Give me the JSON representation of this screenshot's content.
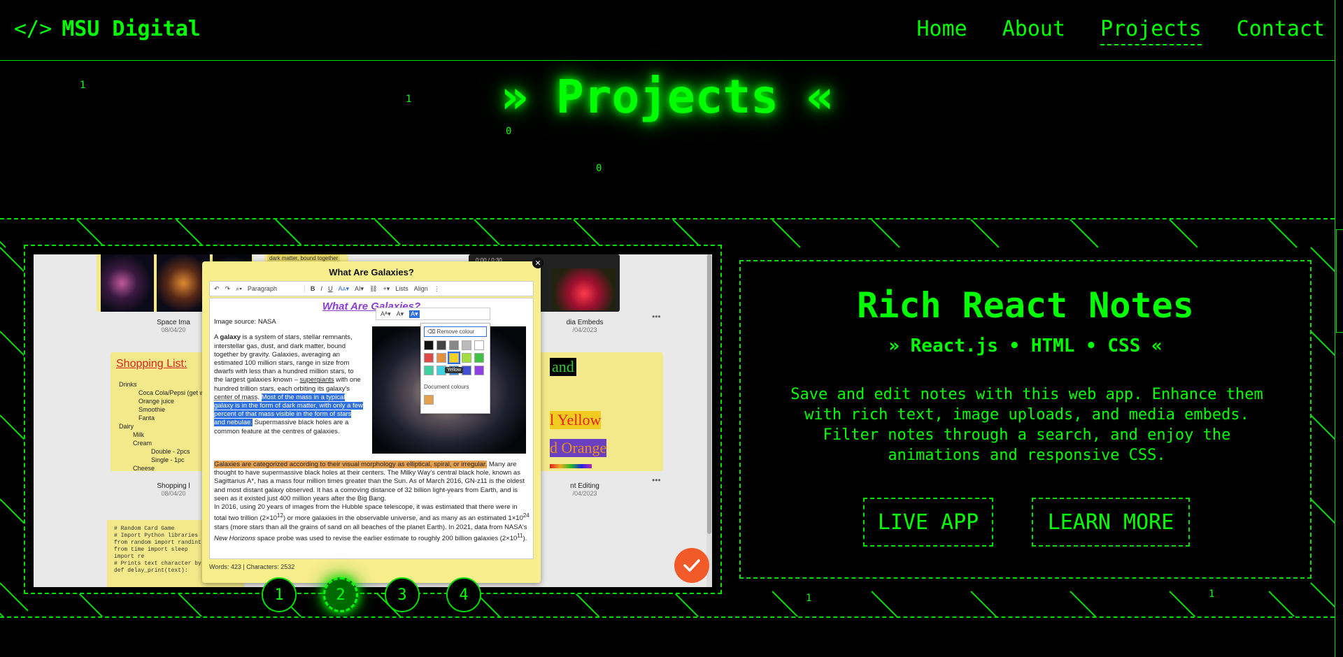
{
  "header": {
    "logo_code": "</>",
    "logo_text": "MSU Digital",
    "nav": [
      {
        "label": "Home",
        "active": false
      },
      {
        "label": "About",
        "active": false
      },
      {
        "label": "Projects",
        "active": true
      },
      {
        "label": "Contact",
        "active": false
      }
    ]
  },
  "matrix_digits": [
    "1",
    "1",
    "0",
    "0",
    "1",
    "1"
  ],
  "page_title": "» Projects «",
  "project": {
    "title": "Rich React Notes",
    "tech": "» React.js • HTML • CSS «",
    "description": "Save and edit notes with this web app. Enhance them with rich text, image uploads, and media embeds. Filter notes through a search, and enjoy the animations and responsive CSS.",
    "live_label": "LIVE APP",
    "learn_label": "LEARN MORE"
  },
  "pager": {
    "pages": [
      "1",
      "2",
      "3",
      "4"
    ],
    "active_index": 1
  },
  "screenshot": {
    "modal_title": "What Are Galaxies?",
    "toolbar_paragraph": "Paragraph",
    "toolbar_lists": "Lists",
    "toolbar_align": "Align",
    "note_heading": "What Are Galaxies?",
    "image_source": "Image source: NASA",
    "para1_a": "A ",
    "para1_bold": "galaxy",
    "para1_b": " is a system of stars, stellar remnants, interstellar gas, dust, and dark matter, bound together by gravity. Galaxies, averaging an estimated 100 million stars, range in size from dwarfs with less than a hundred million stars, to the largest galaxies known – ",
    "para1_link": "supergiants",
    "para1_c": " with one hundred trillion stars, each orbiting its galaxy's ",
    "para1_link2": "center of mass",
    "para1_d": ". ",
    "para1_selected": "Most of the mass in a typical galaxy is in the form of dark matter, with only a few percent of that mass visible in the form of stars and nebulae.",
    "para1_e": " Supermassive black holes are a common feature at the centres of galaxies.",
    "para2_highlight": "Galaxies are categorized according to their visual morphology as elliptical, spiral, or irregular.",
    "para2_a": " Many are thought to have supermassive black holes at their centers. The Milky Way's central black hole, known as Sagittarius A*, has a mass four million times greater than the Sun. As of March 2016, GN-z11 is the oldest and most distant galaxy observed. It has a comoving distance of 32 billion light-years from Earth, and is seen as it existed just 400 million years after the Big Bang.",
    "para2_b": "In 2016, using 20 years of images from the Hubble space telescope, it was estimated that there were in total two trillion (2×10",
    "para2_sup1": "12",
    "para2_c": ") or more galaxies in the observable universe, and as many as an estimated 1×10",
    "para2_sup2": "24",
    "para2_d": " stars (more stars than all the grains of sand on all beaches of the planet Earth). In 2021, data from NASA's ",
    "para2_italic": "New Horizons",
    "para2_e": " space probe was used to revise the earlier estimate to roughly 200 billion galaxies (2×10",
    "para2_sup3": "11",
    "para2_f": ").",
    "word_count": "Words: 423 | Characters: 2532",
    "remove_colour": "Remove colour",
    "document_colours": "Document colours",
    "tooltip": "Yellow",
    "card_top_text": "dark matter, bound together",
    "video_time": "0:00 / 0:30",
    "caption1": "Space Ima",
    "caption1_date": "08/04/20",
    "caption2": "dia Embeds",
    "caption2_date": "/04/2023",
    "shop_title": "Shopping List:",
    "shop_items": [
      "Drinks",
      "Coca Cola/Pepsi (get w",
      "Orange juice",
      "Smoothie",
      "Fanta",
      "Dairy",
      "Milk",
      "Cream",
      "Double - 2pcs",
      "Single - 1pc",
      "Cheese"
    ],
    "caption3": "Shopping l",
    "caption3_date": "08/04/20",
    "caption4": "nt Editing",
    "caption4_date": "/04/2023",
    "right_text1": "and",
    "right_text2": "l Yellow",
    "right_text3": "d Orange",
    "code_lines": [
      "# Random Card Game",
      "",
      "# Import Python libraries",
      "from random import randint",
      "from time import sleep",
      "import re",
      "",
      "# Prints text character by character",
      "def delay_print(text):"
    ]
  },
  "colors": {
    "accent": "#00ff00",
    "background": "#000000",
    "fab": "#f25a2a",
    "note_yellow": "#f8ee8c"
  }
}
